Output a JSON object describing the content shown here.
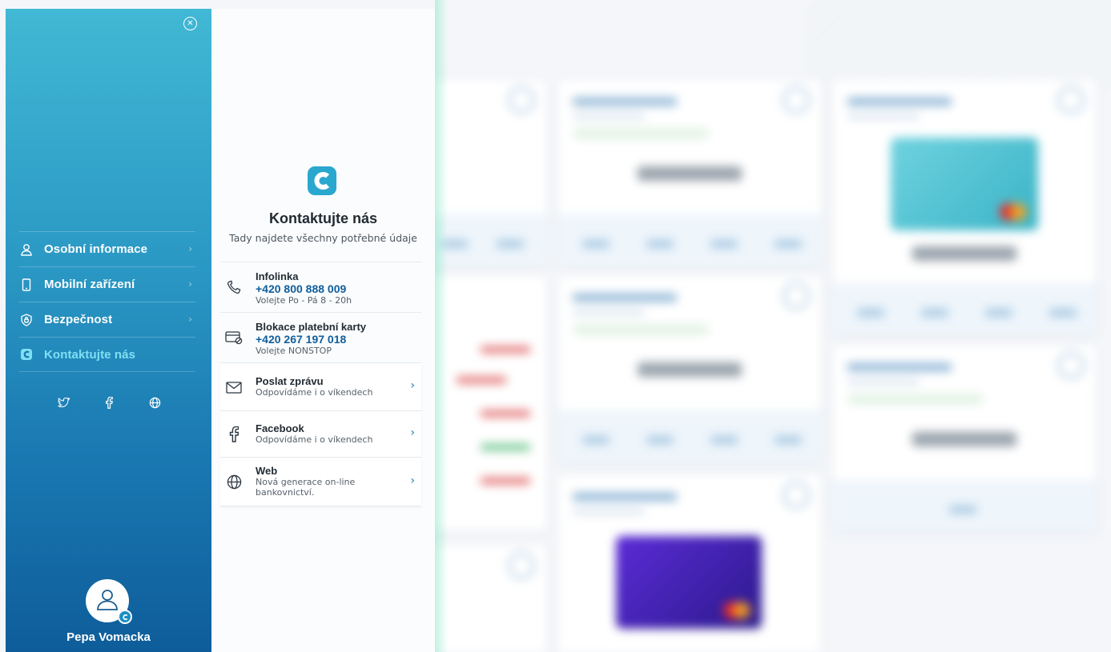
{
  "sidebar": {
    "close_icon": "close-icon",
    "nav": [
      {
        "label": "Osobní informace",
        "icon": "user-icon",
        "active": false
      },
      {
        "label": "Mobilní zařízení",
        "icon": "mobile-icon",
        "active": false
      },
      {
        "label": "Bezpečnost",
        "icon": "shield-icon",
        "active": false
      },
      {
        "label": "Kontaktujte nás",
        "icon": "brand-icon",
        "active": true
      }
    ],
    "socials": [
      "twitter-icon",
      "facebook-icon",
      "globe-icon"
    ],
    "user": {
      "name": "Pepa Vomacka",
      "icon": "user-avatar-icon"
    }
  },
  "contact": {
    "title": "Kontaktujte nás",
    "subtitle": "Tady najdete všechny potřebné údaje",
    "items": [
      {
        "title": "Infolinka",
        "phone": "+420 800 888 009",
        "note": "Volejte Po - Pá 8 - 20h",
        "icon": "phone-icon"
      },
      {
        "title": "Blokace platební karty",
        "phone": "+420 267 197 018",
        "note": "Volejte NONSTOP",
        "icon": "card-block-icon"
      },
      {
        "title": "Poslat zprávu",
        "note": "Odpovídáme i o víkendech",
        "icon": "mail-icon"
      },
      {
        "title": "Facebook",
        "note": "Odpovídáme i o víkendech",
        "icon": "facebook-icon"
      },
      {
        "title": "Web",
        "note": "Nová generace on-line bankovnictví.",
        "icon": "globe-icon"
      }
    ]
  },
  "colors": {
    "sidebar_top": "#41b8d4",
    "sidebar_bottom": "#0e5d9a",
    "active_nav": "#7fe0f3",
    "phone_text": "#0f5e9c",
    "brand": "#2aa7cf"
  }
}
